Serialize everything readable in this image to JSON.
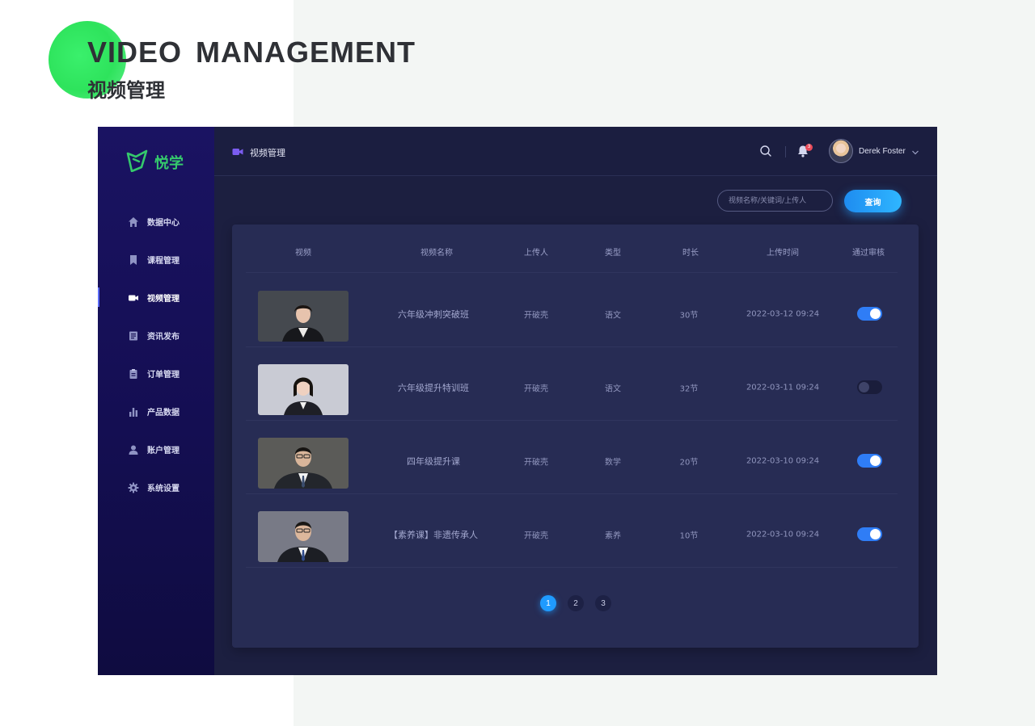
{
  "hero": {
    "title": "VIDEO  MANAGEMENT",
    "subtitle": "视频管理"
  },
  "app": {
    "logo_text": "悦学",
    "nav": [
      {
        "label": "数据中心",
        "icon": "home-icon",
        "active": false
      },
      {
        "label": "课程管理",
        "icon": "bookmark-icon",
        "active": false
      },
      {
        "label": "视频管理",
        "icon": "video-icon",
        "active": true
      },
      {
        "label": "资讯发布",
        "icon": "news-icon",
        "active": false
      },
      {
        "label": "订单管理",
        "icon": "clipboard-icon",
        "active": false
      },
      {
        "label": "产品数据",
        "icon": "bar-chart-icon",
        "active": false
      },
      {
        "label": "账户管理",
        "icon": "user-icon",
        "active": false
      },
      {
        "label": "系统设置",
        "icon": "gear-icon",
        "active": false
      }
    ],
    "topbar": {
      "title": "视频管理",
      "notification_count": "3",
      "user_name": "Derek Foster"
    },
    "search": {
      "placeholder": "视频名称/关键词/上传人",
      "button": "查询"
    },
    "table": {
      "headers": [
        "视频",
        "视频名称",
        "上传人",
        "类型",
        "时长",
        "上传时间",
        "通过审核"
      ],
      "rows": [
        {
          "name": "六年级冲刺突破班",
          "uploader": "开破壳",
          "type": "语文",
          "duration": "30节",
          "time": "2022-03-12 09:24",
          "approved": true
        },
        {
          "name": "六年级提升特训班",
          "uploader": "开破壳",
          "type": "语文",
          "duration": "32节",
          "time": "2022-03-11 09:24",
          "approved": false
        },
        {
          "name": "四年级提升课",
          "uploader": "开破壳",
          "type": "数学",
          "duration": "20节",
          "time": "2022-03-10 09:24",
          "approved": true
        },
        {
          "name": "【素养课】非遗传承人",
          "uploader": "开破壳",
          "type": "素养",
          "duration": "10节",
          "time": "2022-03-10 09:24",
          "approved": true
        }
      ]
    },
    "pagination": {
      "pages": [
        "1",
        "2",
        "3"
      ],
      "current": "1"
    },
    "colors": {
      "accent": "#2f7df6",
      "brand_green": "#35c96c",
      "sidebar": "#1a1362",
      "panel": "#272c54"
    }
  }
}
